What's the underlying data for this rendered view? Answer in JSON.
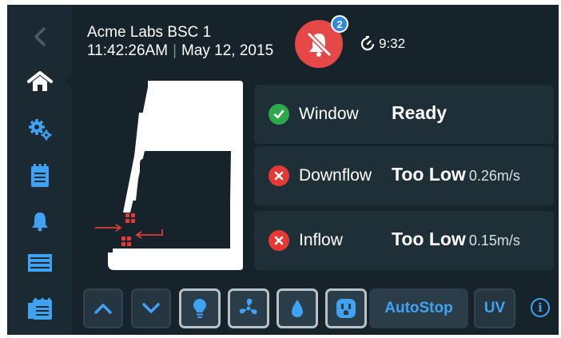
{
  "header": {
    "title": "Acme Labs BSC 1",
    "time": "11:42:26AM",
    "separator": "|",
    "date": "May 12, 2015",
    "alarm_count": "2",
    "timer": "9:32"
  },
  "sidebar": {
    "items": [
      {
        "name": "back",
        "icon": "chevron-left-icon"
      },
      {
        "name": "home",
        "icon": "home-icon",
        "active": true
      },
      {
        "name": "settings",
        "icon": "gears-icon"
      },
      {
        "name": "log",
        "icon": "clipboard-icon"
      },
      {
        "name": "alarms",
        "icon": "bell-icon"
      },
      {
        "name": "filters",
        "icon": "filter-icon"
      },
      {
        "name": "reports",
        "icon": "report-icon"
      }
    ]
  },
  "status_panels": [
    {
      "label": "Window",
      "status": "Ready",
      "value": "",
      "state": "ok"
    },
    {
      "label": "Downflow",
      "status": "Too Low",
      "value": "0.26m/s",
      "state": "error"
    },
    {
      "label": "Inflow",
      "status": "Too Low",
      "value": "0.15m/s",
      "state": "error"
    }
  ],
  "controls": {
    "autostop_label": "AutoStop",
    "uv_label": "UV",
    "info_label": "i"
  },
  "colors": {
    "background": "#17232a",
    "sidebar": "#1b2a32",
    "accent": "#3fa2f2",
    "alarm": "#e64747",
    "ok": "#2ea84a",
    "error": "#e53935",
    "badge": "#2f8ad9"
  }
}
